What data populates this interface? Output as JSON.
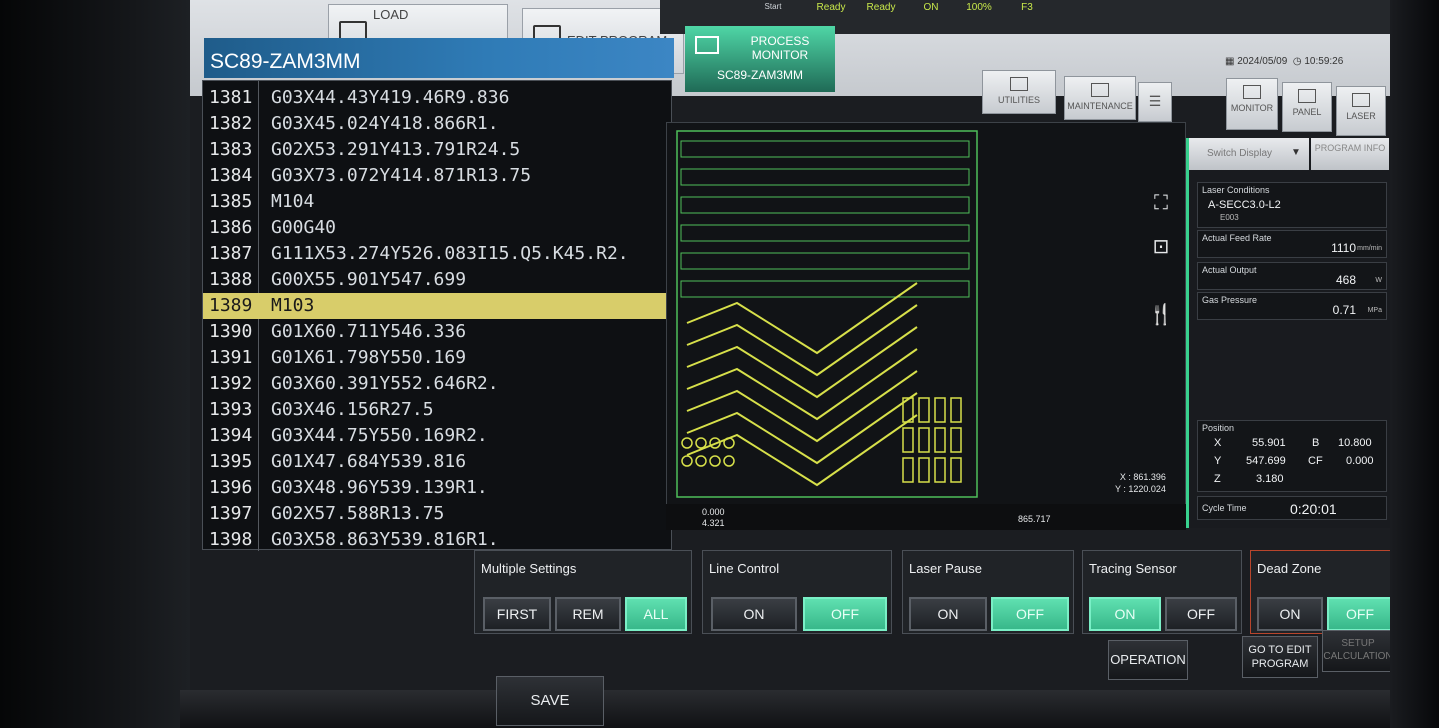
{
  "status": [
    {
      "label": "Start",
      "value": ""
    },
    {
      "label": "",
      "value": "Ready"
    },
    {
      "label": "",
      "value": "Ready"
    },
    {
      "label": "",
      "value": "ON"
    },
    {
      "label": "",
      "value": "100%"
    },
    {
      "label": "",
      "value": "F3"
    }
  ],
  "tabs": {
    "load": "LOAD",
    "edit_program": "EDIT PROGRAM",
    "process_monitor": "PROCESS MONITOR",
    "process_monitor_sub": "SC89-ZAM3MM"
  },
  "datetime": {
    "date": "2024/05/09",
    "time": "10:59:26"
  },
  "toolbar": {
    "utilities": "UTILITIES",
    "maintenance": "MAINTENANCE",
    "monitor": "MONITOR",
    "panel": "PANEL",
    "laser": "LASER"
  },
  "program": {
    "title": "SC89-ZAM3MM",
    "selected_line": "1389",
    "lines": [
      {
        "n": "1381",
        "code": "G03X44.43Y419.46R9.836"
      },
      {
        "n": "1382",
        "code": "G03X45.024Y418.866R1."
      },
      {
        "n": "1383",
        "code": "G02X53.291Y413.791R24.5"
      },
      {
        "n": "1384",
        "code": "G03X73.072Y414.871R13.75"
      },
      {
        "n": "1385",
        "code": "M104"
      },
      {
        "n": "1386",
        "code": "G00G40"
      },
      {
        "n": "1387",
        "code": "G111X53.274Y526.083I15.Q5.K45.R2."
      },
      {
        "n": "1388",
        "code": "G00X55.901Y547.699"
      },
      {
        "n": "1389",
        "code": "M103"
      },
      {
        "n": "1390",
        "code": "G01X60.711Y546.336"
      },
      {
        "n": "1391",
        "code": "G01X61.798Y550.169"
      },
      {
        "n": "1392",
        "code": "G03X60.391Y552.646R2."
      },
      {
        "n": "1393",
        "code": "G03X46.156R27.5"
      },
      {
        "n": "1394",
        "code": "G03X44.75Y550.169R2."
      },
      {
        "n": "1395",
        "code": "G01X47.684Y539.816"
      },
      {
        "n": "1396",
        "code": "G03X48.96Y539.139R1."
      },
      {
        "n": "1397",
        "code": "G02X57.588R13.75"
      },
      {
        "n": "1398",
        "code": "G03X58.863Y539.816R1."
      }
    ]
  },
  "preview": {
    "coord_x": "X : 861.396",
    "coord_y": "Y : 1220.024",
    "axis_start": "0.000",
    "axis_start_sub": "4.321",
    "axis_end": "865.717",
    "outline_color": "#d7e04a",
    "sheet_color": "#4fbf5a"
  },
  "info": {
    "switch_display": "Switch Display",
    "program_info": "PROGRAM INFO",
    "laser_conditions_label": "Laser Conditions",
    "laser_conditions_value": "A-SECC3.0-L2",
    "laser_conditions_code": "E003",
    "feed_rate_label": "Actual Feed Rate",
    "feed_rate_value": "1110",
    "feed_rate_unit": "mm/min",
    "output_label": "Actual Output",
    "output_value": "468",
    "output_unit": "W",
    "gas_label": "Gas Pressure",
    "gas_value": "0.71",
    "gas_unit": "MPa",
    "position_label": "Position",
    "x_label": "X",
    "x_value": "55.901",
    "y_label": "Y",
    "y_value": "547.699",
    "z_label": "Z",
    "z_value": "3.180",
    "b_label": "B",
    "b_value": "10.800",
    "cf_label": "CF",
    "cf_value": "0.000",
    "cycle_label": "Cycle Time",
    "cycle_value": "0:20:01"
  },
  "controls": {
    "multiple_settings": {
      "title": "Multiple Settings",
      "first": "FIRST",
      "rem": "REM",
      "all": "ALL",
      "active": "all"
    },
    "line_control": {
      "title": "Line Control",
      "on": "ON",
      "off": "OFF",
      "active": "off"
    },
    "laser_pause": {
      "title": "Laser Pause",
      "on": "ON",
      "off": "OFF",
      "active": "off"
    },
    "tracing_sensor": {
      "title": "Tracing Sensor",
      "on": "ON",
      "off": "OFF",
      "active": "on"
    },
    "dead_zone": {
      "title": "Dead Zone",
      "on": "ON",
      "off": "OFF",
      "active": "off"
    }
  },
  "actions": {
    "operation": "OPERATION",
    "go_to_edit": "GO TO EDIT PROGRAM",
    "setup_calc": "SETUP CALCULATION",
    "save": "SAVE"
  },
  "colors": {
    "accent_green": "#4fd6a6",
    "highlight_yellow": "#d8cd6a",
    "title_blue": "#2f7bb6"
  }
}
